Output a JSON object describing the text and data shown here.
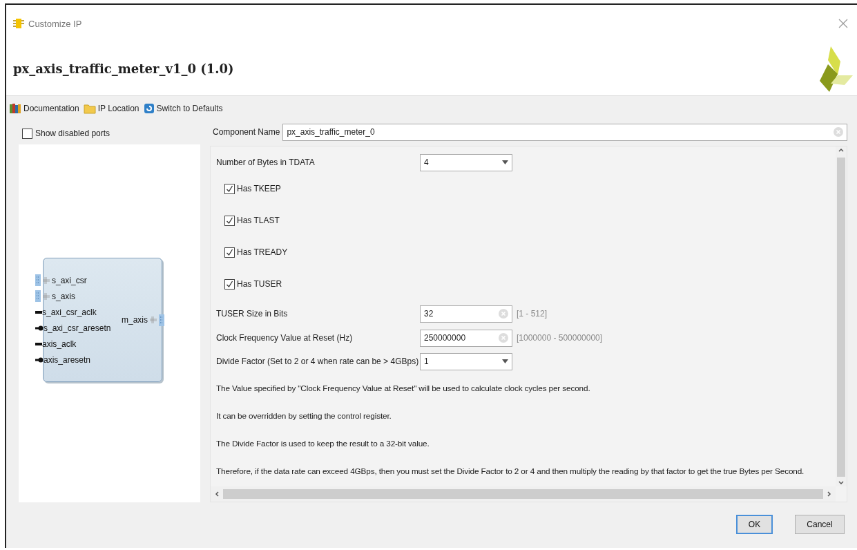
{
  "window": {
    "title": "Customize IP"
  },
  "header": {
    "title": "px_axis_traffic_meter_v1_0 (1.0)"
  },
  "toolbar": [
    {
      "label": "Documentation",
      "kind": "docs"
    },
    {
      "label": "IP Location",
      "kind": "folder"
    },
    {
      "label": "Switch to Defaults",
      "kind": "reset"
    }
  ],
  "symbol_panel": {
    "show_disabled_ports": {
      "label": "Show disabled ports",
      "checked": false
    },
    "left_ports": [
      {
        "name": "s_axi_csr",
        "kind": "bus"
      },
      {
        "name": "s_axis",
        "kind": "bus"
      },
      {
        "name": "s_axi_csr_aclk",
        "kind": "clock"
      },
      {
        "name": "s_axi_csr_aresetn",
        "kind": "reset"
      },
      {
        "name": "axis_aclk",
        "kind": "clock"
      },
      {
        "name": "axis_aresetn",
        "kind": "reset"
      }
    ],
    "right_ports": [
      {
        "name": "m_axis",
        "kind": "bus"
      }
    ]
  },
  "component_name": {
    "label": "Component Name",
    "value": "px_axis_traffic_meter_0"
  },
  "parameters": [
    {
      "kind": "select",
      "label": "Number of Bytes in TDATA",
      "value": "4"
    },
    {
      "kind": "checkbox",
      "label": "Has TKEEP",
      "checked": true
    },
    {
      "kind": "checkbox",
      "label": "Has TLAST",
      "checked": true
    },
    {
      "kind": "checkbox",
      "label": "Has TREADY",
      "checked": true
    },
    {
      "kind": "checkbox",
      "label": "Has TUSER",
      "checked": true
    },
    {
      "kind": "text",
      "label": "TUSER Size in Bits",
      "value": "32",
      "range": "[1 - 512]"
    },
    {
      "kind": "text",
      "label": "Clock Frequency Value at Reset (Hz)",
      "value": "250000000",
      "range": "[1000000 - 500000000]"
    },
    {
      "kind": "select",
      "label": "Divide Factor (Set to 2 or 4 when rate can be > 4GBps)",
      "value": "1"
    }
  ],
  "notes": [
    "The Value specified by \"Clock Frequency Value at Reset\" will be used to calculate clock cycles per second.",
    "It can be overridden by setting the control register.",
    "The Divide Factor is used to keep the result to a 32-bit value.",
    "Therefore, if the data rate can exceed 4GBps, then you must set the Divide Factor to 2 or 4 and then multiply the reading by that factor to get the true Bytes per Second."
  ],
  "buttons": [
    {
      "label": "OK",
      "default": true
    },
    {
      "label": "Cancel",
      "default": false
    }
  ]
}
